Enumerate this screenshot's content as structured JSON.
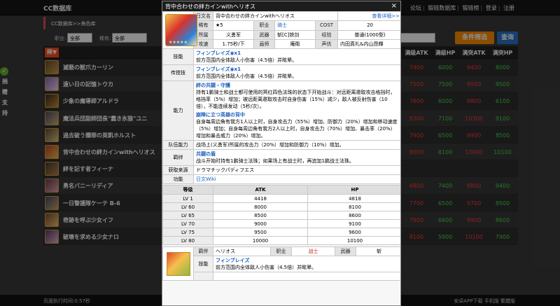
{
  "header": {
    "site_title": "CC数据库",
    "links": [
      "论坛",
      "锻链数据库",
      "锻链榜",
      "登录",
      "注册"
    ]
  },
  "breadcrumb": "CC数据库>>角色库",
  "filters": {
    "job_label": "职业:",
    "job_value": "全部",
    "rarity_label": "稀有:",
    "rarity_value": "全部",
    "filter_button": "条件筛选",
    "query_button": "查询"
  },
  "side_badge": {
    "check": "✓",
    "text": [
      "捐",
      "赠",
      "支",
      "持"
    ]
  },
  "list": {
    "sort_label": "稀▼",
    "columns": [
      "满级ATK",
      "满级HP",
      "满突ATK",
      "满突HP"
    ],
    "rows": [
      {
        "name": "滅褻の獣爪カーリン",
        "atk": "7400",
        "hp": "6000",
        "tatk": "9400",
        "thp": "8000"
      },
      {
        "name": "遠い日の記憶トウカ",
        "atk": "7500",
        "hp": "7500",
        "tatk": "9500",
        "thp": "9500"
      },
      {
        "name": "少象の魔導師アルドラ",
        "atk": "7800",
        "hp": "6000",
        "tatk": "9800",
        "thp": "6100"
      },
      {
        "name": "魔法兵団副師団長\"蠢き氷狼\"ユニ",
        "atk": "8300",
        "hp": "7100",
        "tatk": "10300",
        "thp": "9100"
      },
      {
        "name": "過去破う贖罪の英凱ホルスト",
        "atk": "7900",
        "hp": "6500",
        "tatk": "9900",
        "thp": "8500"
      },
      {
        "name": "背中合わせの絆カインwithヘリオス",
        "atk": "8000",
        "hp": "8100",
        "tatk": "10000",
        "thp": "10100"
      },
      {
        "name": "絆を記す者フィーナ",
        "atk": "",
        "hp": "",
        "tatk": "",
        "thp": ""
      },
      {
        "name": "勇名バニーリディア",
        "atk": "6800",
        "hp": "7400",
        "tatk": "8800",
        "thp": "9400"
      },
      {
        "name": "一日警護隊ケーテ B-6",
        "atk": "7700",
        "hp": "6500",
        "tatk": "9700",
        "thp": "8500"
      },
      {
        "name": "奇跡を呼ぶ少女イフ",
        "atk": "7900",
        "hp": "6600",
        "tatk": "9900",
        "thp": "8600"
      },
      {
        "name": "破壊を求める少女ナロ",
        "atk": "8100",
        "hp": "5900",
        "tatk": "10100",
        "thp": "7900"
      }
    ]
  },
  "footer": {
    "left": "页面执行时间:0.57秒",
    "right": "安卓APP下载 手机版 繁體版"
  },
  "popup": {
    "title": "背中合わせの絆カインwithヘリオス",
    "close": "×",
    "jp_name_label": "日文名",
    "jp_name": "背中合わせの絆カインwithヘリオス",
    "view_detail": "查看详细>>",
    "rarity_label": "稀有",
    "rarity": "★5",
    "job_label": "职业",
    "job": "骑士",
    "cost_label": "COST",
    "cost": "20",
    "affiliation_label": "所属",
    "affiliation": "义勇军",
    "weapon_label": "武器",
    "weapon": "斩[C]铁剑",
    "exp_label": "经验",
    "exp": "普通(1000型)",
    "attack_label": "攻速",
    "attack": "1.75秒/下",
    "illust_label": "画师",
    "illust": "庵衛",
    "cv_label": "声优",
    "cv": "内田真礼&内山昂輝",
    "skill_label": "技能",
    "skill_name": "フィンブレイズ◉x1",
    "skill_desc": "前方范围内全体敌人小伤害（4.5倍）并眩晕。",
    "inherit_label": "传授技",
    "inherit_name": "フィンブレイズ◉x1",
    "inherit_desc": "前方范围内全体敌人小伤害（4.5倍）并眩晕。",
    "ability_label": "能力",
    "ability1_name": "絆の共闘・守護",
    "ability1_desc": "持有1鹏骑士和战士都可使用的冥红四色法珠的状态下开始战斗：对远距离邀取攻击格挡时，格挡率（5%）增加；被远距离邀取攻击时自身伤害（15%）减少，敌人被反射伤害（10倍），不能连续发动（5秒/次）。",
    "ability2_name": "崩陣に立つ英雄の背中",
    "ability2_desc": "自身每周边角有我方1人以上时，自身攻击力（55%）增加、防御力（20%）增加和移动速度（5%）增加；自身每周边角有我方2人以上时，自身攻击力（70%）增加、暴击率（20%）增加和暴击威力（20%）增加。",
    "team_label": "队伍能力",
    "team_desc": "战场上(义勇军)所属的攻击力（20%）增加和防御力（10%）增加。",
    "awake_label": "羁绊",
    "awake_name": "共闘の盾",
    "awake_desc": "战斗开始时持有1鹏骑士法珠；如果场上有战士时，再追加1鹏战士法珠。",
    "source_label": "获取来源",
    "source": "ドラマチックパディフエス",
    "func_label": "功能",
    "func": "日文Wiki",
    "stats_headers": [
      "等级",
      "ATK",
      "HP"
    ],
    "stats": [
      {
        "lv": "LV 1",
        "atk": "4418",
        "hp": "4818"
      },
      {
        "lv": "LV 60",
        "atk": "8000",
        "hp": "8100"
      },
      {
        "lv": "LV 65",
        "atk": "8500",
        "hp": "8600"
      },
      {
        "lv": "LV 70",
        "atk": "9000",
        "hp": "9100"
      },
      {
        "lv": "LV 75",
        "atk": "9500",
        "hp": "9600"
      },
      {
        "lv": "LV 80",
        "atk": "10000",
        "hp": "10100"
      }
    ],
    "partner_label": "羁伴",
    "partner_name": "ヘリオス",
    "partner_job_label": "职业",
    "partner_job": "战士",
    "partner_weapon_label": "武器",
    "partner_weapon": "斩",
    "partner_skill_label": "技能",
    "partner_skill_name": "フィンブレイズ",
    "partner_skill_desc": "前方范围内全体敌人小伤害（4.5倍）并眩晕。"
  }
}
